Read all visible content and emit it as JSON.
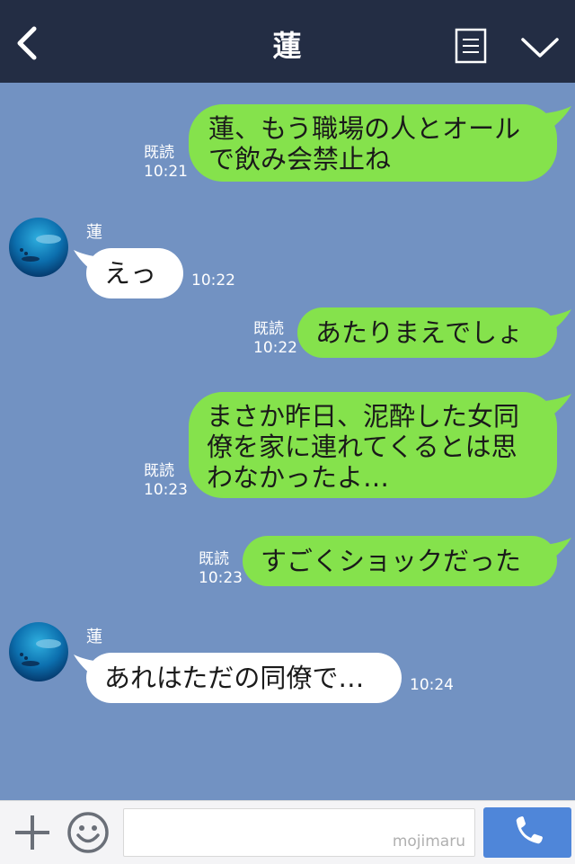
{
  "header": {
    "title": "蓮",
    "background": "#232d44"
  },
  "colors": {
    "chat_background": "#7292c2",
    "outgoing_bubble": "#85e24c",
    "incoming_bubble": "#ffffff",
    "call_button": "#4f86d9"
  },
  "messages": [
    {
      "direction": "out",
      "read_label": "既読",
      "time": "10:21",
      "text": "蓮、もう職場の人とオール\nで飲み会禁止ね"
    },
    {
      "direction": "in",
      "sender": "蓮",
      "time": "10:22",
      "text": "えっ"
    },
    {
      "direction": "out",
      "read_label": "既読",
      "time": "10:22",
      "text": "あたりまえでしょ"
    },
    {
      "direction": "out",
      "read_label": "既読",
      "time": "10:23",
      "text": "まさか昨日、泥酔した女同\n僚を家に連れてくるとは思\nわなかったよ…"
    },
    {
      "direction": "out",
      "read_label": "既読",
      "time": "10:23",
      "text": "すごくショックだった"
    },
    {
      "direction": "in",
      "sender": "蓮",
      "time": "10:24",
      "text": "あれはただの同僚で…"
    }
  ],
  "input": {
    "watermark": "mojimaru"
  },
  "icons": {
    "back": "chevron-left-icon",
    "notes": "notes-icon",
    "collapse": "chevron-down-icon",
    "plus": "plus-icon",
    "emoji": "smiley-icon",
    "call": "phone-icon"
  }
}
